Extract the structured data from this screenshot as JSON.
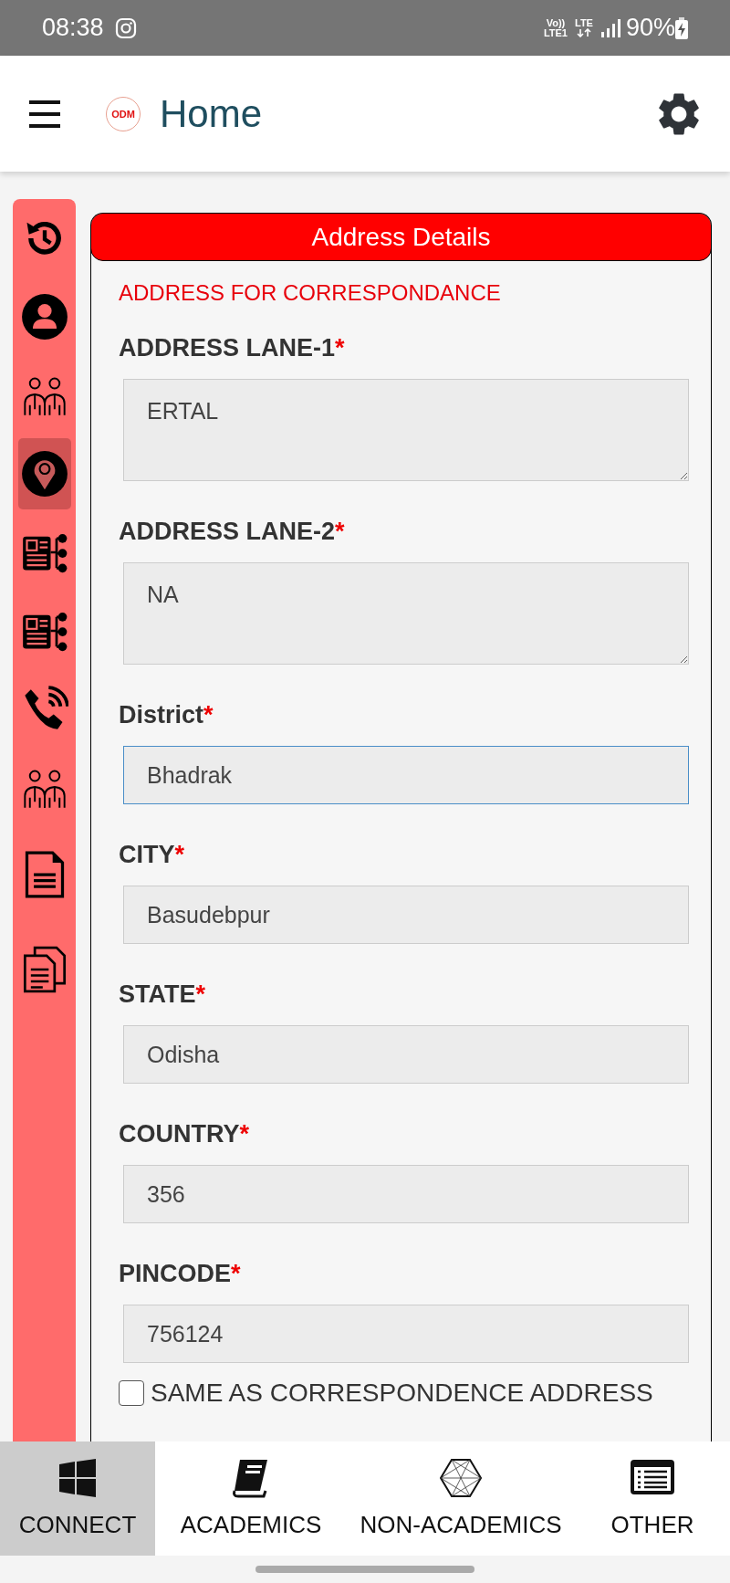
{
  "status_bar": {
    "time": "08:38",
    "volte": "Vo))",
    "volte_sub": "LTE1",
    "data": "LTE",
    "battery": "90%"
  },
  "header": {
    "logo_text": "ODM",
    "title": "Home"
  },
  "sidebar": {
    "items": [
      {
        "kind": "history",
        "selected": false
      },
      {
        "kind": "user",
        "selected": false
      },
      {
        "kind": "people",
        "selected": false
      },
      {
        "kind": "location",
        "selected": true
      },
      {
        "kind": "idcard",
        "selected": false
      },
      {
        "kind": "idcard",
        "selected": false
      },
      {
        "kind": "phone",
        "selected": false
      },
      {
        "kind": "people",
        "selected": false
      },
      {
        "kind": "document",
        "selected": false
      },
      {
        "kind": "documents",
        "selected": false
      }
    ]
  },
  "card": {
    "title": "Address Details",
    "subtitle": "ADDRESS FOR CORRESPONDANCE",
    "fields": [
      {
        "label": "ADDRESS LANE-1",
        "mark": "*",
        "kind": "textarea",
        "value": "ERTAL",
        "focused": false
      },
      {
        "label": "ADDRESS LANE-2",
        "mark": "*",
        "kind": "textarea",
        "value": "NA",
        "focused": false
      },
      {
        "label": "District",
        "mark": "*",
        "kind": "input",
        "value": "Bhadrak",
        "focused": true
      },
      {
        "label": "CITY",
        "mark": "*",
        "kind": "input",
        "value": "Basudebpur",
        "focused": false
      },
      {
        "label": "STATE",
        "mark": "*",
        "kind": "input",
        "value": "Odisha",
        "focused": false
      },
      {
        "label": "COUNTRY",
        "mark": "*",
        "kind": "input",
        "value": "356",
        "focused": false
      },
      {
        "label": "PINCODE",
        "mark": "*",
        "kind": "input",
        "value": "756124",
        "focused": false
      }
    ],
    "same_address": {
      "label": "SAME AS CORRESPONDENCE ADDRESS",
      "checked": false
    }
  },
  "bottom_nav": {
    "tabs": [
      {
        "kind": "windows",
        "label": "CONNECT",
        "selected": true
      },
      {
        "kind": "book",
        "label": "ACADEMICS",
        "selected": false
      },
      {
        "kind": "polygon",
        "label": "NON-ACADEMICS",
        "selected": false
      },
      {
        "kind": "list",
        "label": "OTHER",
        "selected": false
      }
    ]
  }
}
